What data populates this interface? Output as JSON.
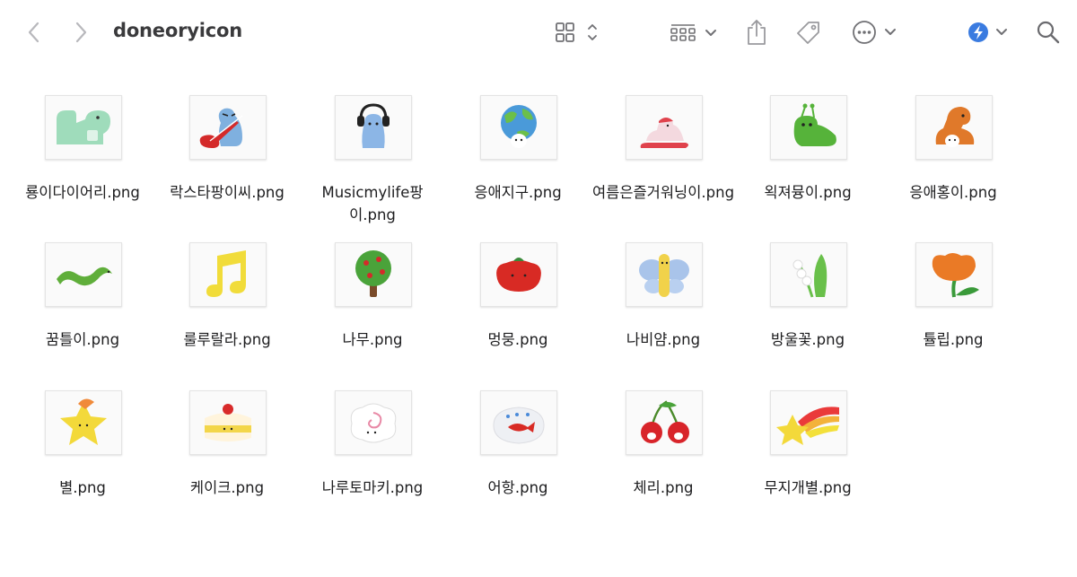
{
  "window": {
    "title": "doneoryicon"
  },
  "icons": {
    "back": "chevron-left-icon",
    "forward": "chevron-right-icon",
    "view": "grid-view-icon",
    "group": "group-by-icon",
    "share": "share-icon",
    "tags": "tag-icon",
    "more": "ellipsis-circle-icon",
    "shortcuts": "shortcuts-icon",
    "search": "search-icon"
  },
  "files": [
    {
      "name": "룡이다이어리.png",
      "motif": "green-dinosaur"
    },
    {
      "name": "락스타팡이씨.png",
      "motif": "blue-guitar-creature"
    },
    {
      "name": "Musicmylife팡이.png",
      "motif": "blue-headphone-creature"
    },
    {
      "name": "응애지구.png",
      "motif": "earth-baby"
    },
    {
      "name": "여름은즐거워닝이.png",
      "motif": "pink-swimmer"
    },
    {
      "name": "왹져뮹이.png",
      "motif": "green-alien-caterpillar"
    },
    {
      "name": "응애홍이.png",
      "motif": "orange-dinosaur"
    },
    {
      "name": "꿈틀이.png",
      "motif": "green-worm"
    },
    {
      "name": "룰루랄라.png",
      "motif": "yellow-music-note"
    },
    {
      "name": "나무.png",
      "motif": "apple-tree"
    },
    {
      "name": "멍뭉.png",
      "motif": "red-puppy"
    },
    {
      "name": "나비얌.png",
      "motif": "butterfly"
    },
    {
      "name": "방울꽃.png",
      "motif": "lily-of-the-valley"
    },
    {
      "name": "튤립.png",
      "motif": "tulip"
    },
    {
      "name": "별.png",
      "motif": "yellow-star"
    },
    {
      "name": "케이크.png",
      "motif": "cake"
    },
    {
      "name": "나루토마키.png",
      "motif": "narutomaki"
    },
    {
      "name": "어항.png",
      "motif": "fish-bowl"
    },
    {
      "name": "체리.png",
      "motif": "cherry"
    },
    {
      "name": "무지개별.png",
      "motif": "rainbow-star"
    }
  ]
}
